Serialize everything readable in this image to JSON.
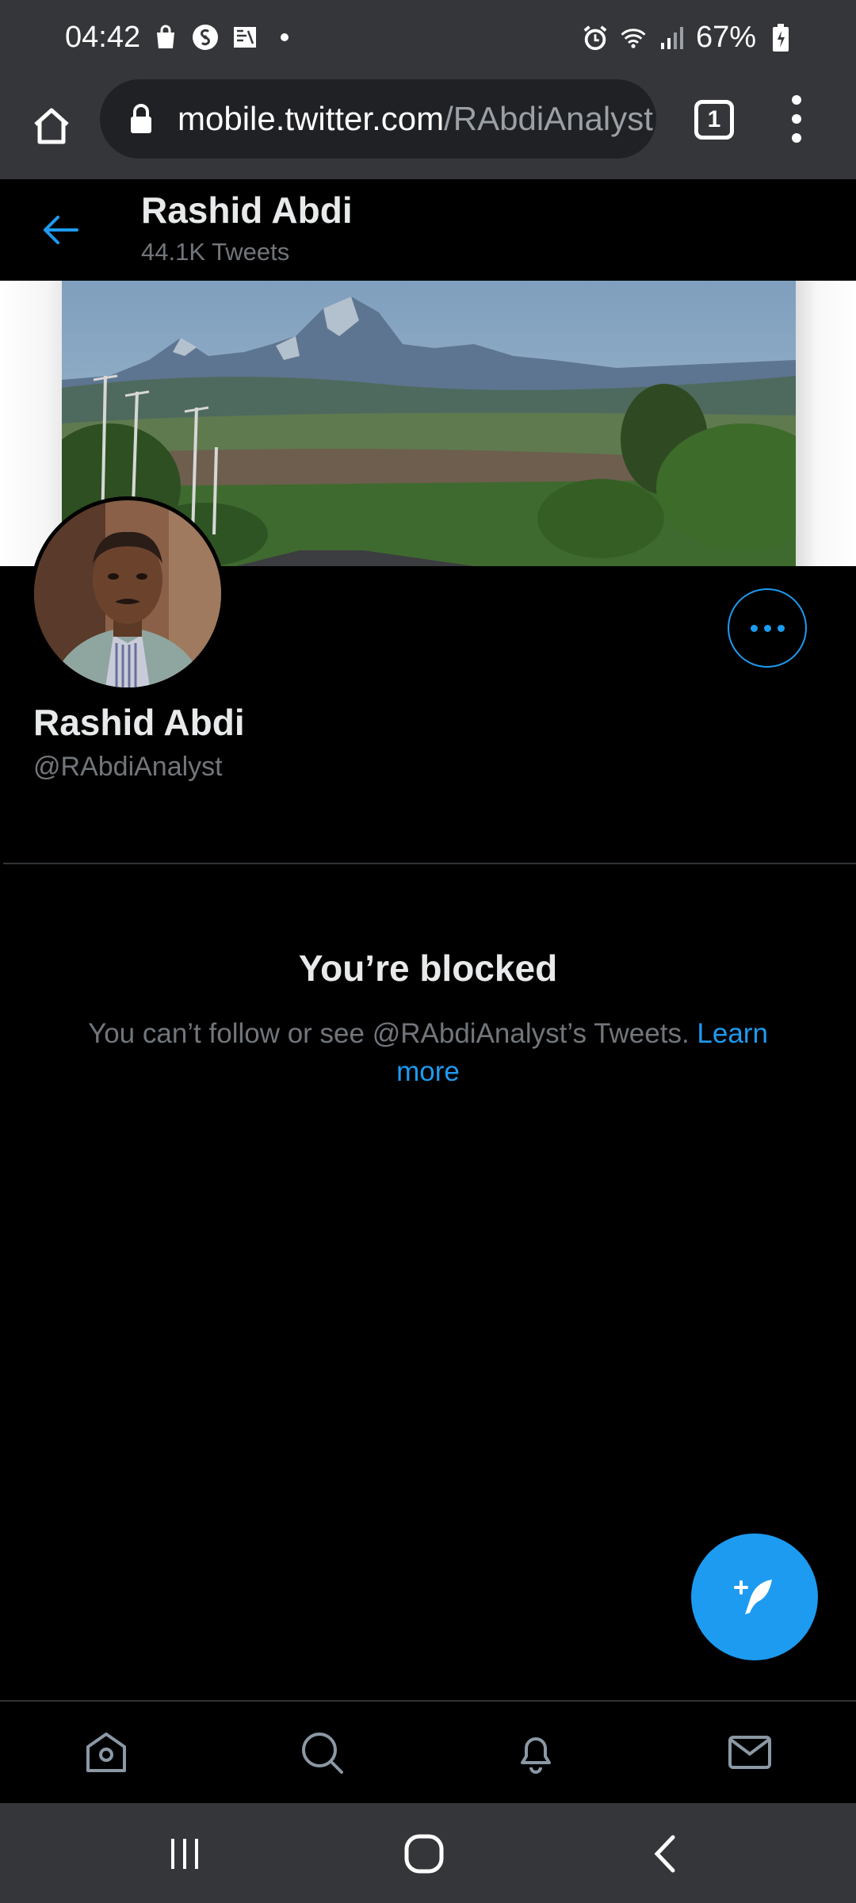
{
  "status_bar": {
    "time": "04:42",
    "battery": "67%",
    "left_icons": [
      "shopping-bag-icon",
      "shazam-icon",
      "gallery-icon",
      "dot-icon"
    ],
    "right_icons": [
      "alarm-icon",
      "wifi-icon",
      "signal-icon",
      "battery-icon"
    ]
  },
  "browser": {
    "url_host": "mobile.twitter.com",
    "url_path": "/RAbdiAnalyst",
    "tab_count": "1"
  },
  "header": {
    "name": "Rashid Abdi",
    "tweet_count": "44.1K Tweets"
  },
  "profile": {
    "name": "Rashid Abdi",
    "handle": "@RAbdiAnalyst"
  },
  "blocked": {
    "title": "You’re blocked",
    "message": "You can’t follow or see @RAbdiAnalyst’s Tweets. ",
    "link": "Learn more"
  },
  "colors": {
    "accent": "#1d9bf0",
    "background": "#000000",
    "chrome": "#35363a",
    "secondary_text": "#71767b"
  }
}
